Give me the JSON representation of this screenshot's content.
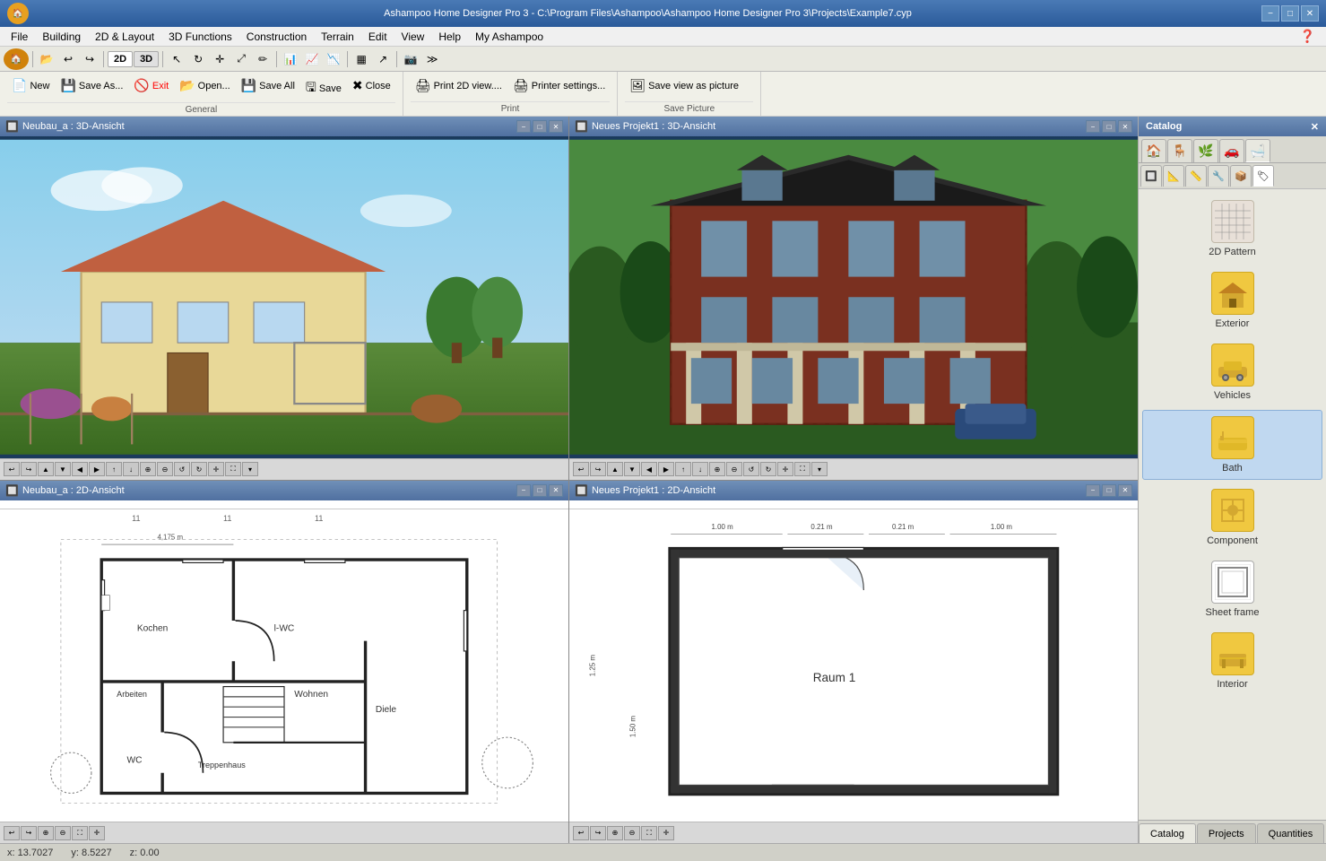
{
  "title_bar": {
    "title": "Ashampoo Home Designer Pro 3 - C:\\Program Files\\Ashampoo\\Ashampoo Home Designer Pro 3\\Projects\\Example7.cyp",
    "app_icon": "🏠",
    "win_minimize": "−",
    "win_maximize": "□",
    "win_close": "✕"
  },
  "menu": {
    "items": [
      "File",
      "Building",
      "2D & Layout",
      "3D Functions",
      "Construction",
      "Terrain",
      "Edit",
      "View",
      "Help",
      "My Ashampoo"
    ]
  },
  "quick_toolbar": {
    "view2d": "2D",
    "view3d": "3D"
  },
  "file_menu": {
    "new_label": "New",
    "save_as_label": "Save As...",
    "exit_label": "Exit",
    "open_label": "Open...",
    "save_all_label": "Save All",
    "save_label": "Save",
    "close_label": "Close",
    "group_label": "General"
  },
  "print_menu": {
    "print_2d_label": "Print 2D view....",
    "printer_settings_label": "Printer settings...",
    "group_label": "Print"
  },
  "save_picture_menu": {
    "save_view_label": "Save view as picture",
    "group_label": "Save Picture"
  },
  "viewports": [
    {
      "id": "vp-tl",
      "title": "Neubau_a : 3D-Ansicht",
      "type": "3d",
      "position": "top-left"
    },
    {
      "id": "vp-tr",
      "title": "Neues Projekt1 : 3D-Ansicht",
      "type": "3d",
      "position": "top-right"
    },
    {
      "id": "vp-bl",
      "title": "Neubau_a : 2D-Ansicht",
      "type": "2d",
      "position": "bottom-left"
    },
    {
      "id": "vp-br",
      "title": "Neues Projekt1 : 2D-Ansicht",
      "type": "2d",
      "position": "bottom-right"
    }
  ],
  "catalog": {
    "title": "Catalog",
    "tabs": [
      "🏠",
      "🪑",
      "🌿",
      "🚗",
      "🛁"
    ],
    "items": [
      {
        "id": "2d-pattern",
        "label": "2D Pattern",
        "icon": "▦",
        "type": "pattern"
      },
      {
        "id": "exterior",
        "label": "Exterior",
        "icon": "🏠",
        "type": "folder",
        "selected": false
      },
      {
        "id": "vehicles",
        "label": "Vehicles",
        "icon": "🚗",
        "type": "folder"
      },
      {
        "id": "bath",
        "label": "Bath",
        "icon": "🛁",
        "type": "folder"
      },
      {
        "id": "component",
        "label": "Component",
        "icon": "⚙",
        "type": "folder"
      },
      {
        "id": "sheet-frame",
        "label": "Sheet frame",
        "icon": "□",
        "type": "white-folder"
      },
      {
        "id": "interior",
        "label": "Interior",
        "icon": "🛋",
        "type": "folder"
      },
      {
        "id": "more",
        "label": "...",
        "icon": "📁",
        "type": "folder"
      }
    ],
    "selected_tab": 5
  },
  "bottom_tabs": [
    {
      "id": "catalog",
      "label": "Catalog",
      "active": true
    },
    {
      "id": "projects",
      "label": "Projects"
    },
    {
      "id": "quantities",
      "label": "Quantities"
    }
  ],
  "status_bar": {
    "x": "x: 13.7027",
    "y": "y: 8.5227",
    "z": "z: 0.00"
  }
}
